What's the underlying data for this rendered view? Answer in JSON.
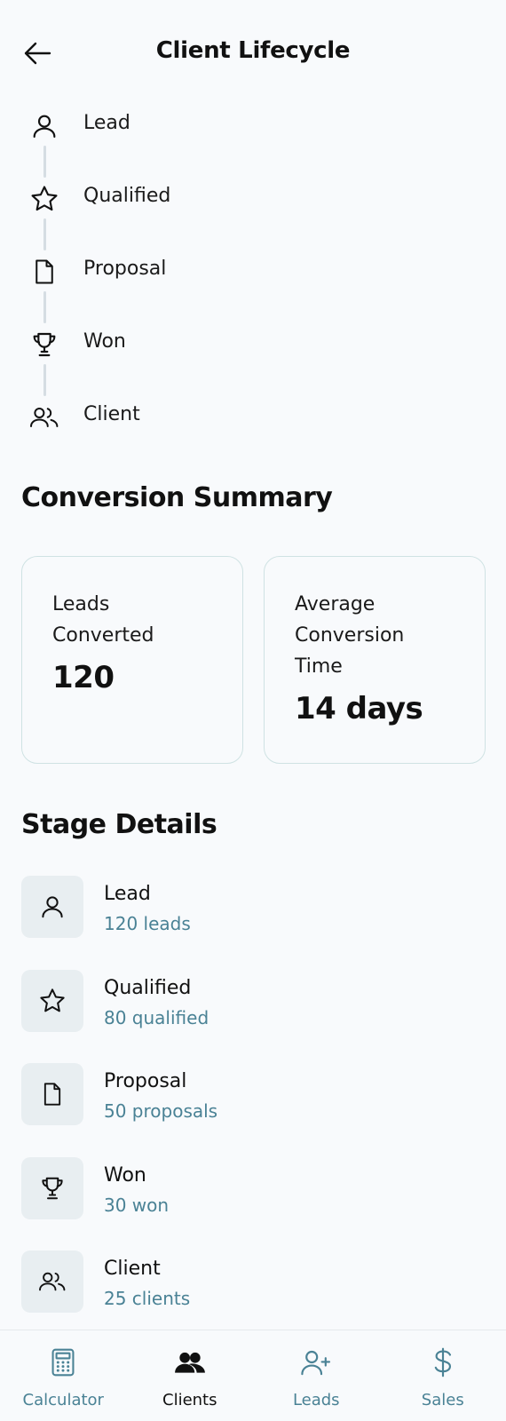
{
  "header": {
    "title": "Client Lifecycle"
  },
  "timeline": [
    {
      "label": "Lead",
      "icon": "user-icon"
    },
    {
      "label": "Qualified",
      "icon": "star-icon"
    },
    {
      "label": "Proposal",
      "icon": "file-icon"
    },
    {
      "label": "Won",
      "icon": "trophy-icon"
    },
    {
      "label": "Client",
      "icon": "users-icon"
    }
  ],
  "summary": {
    "title": "Conversion Summary",
    "cards": [
      {
        "label": "Leads Converted",
        "value": "120"
      },
      {
        "label": "Average Conversion Time",
        "value": "14 days"
      }
    ]
  },
  "stages": {
    "title": "Stage Details",
    "items": [
      {
        "name": "Lead",
        "count": "120 leads",
        "icon": "user-icon"
      },
      {
        "name": "Qualified",
        "count": "80 qualified",
        "icon": "star-icon"
      },
      {
        "name": "Proposal",
        "count": "50 proposals",
        "icon": "file-icon"
      },
      {
        "name": "Won",
        "count": "30 won",
        "icon": "trophy-icon"
      },
      {
        "name": "Client",
        "count": "25 clients",
        "icon": "users-icon"
      }
    ]
  },
  "nav": {
    "items": [
      {
        "label": "Calculator",
        "icon": "calculator-icon",
        "active": false
      },
      {
        "label": "Clients",
        "icon": "users-filled-icon",
        "active": true
      },
      {
        "label": "Leads",
        "icon": "user-plus-icon",
        "active": false
      },
      {
        "label": "Sales",
        "icon": "dollar-icon",
        "active": false
      }
    ]
  },
  "colors": {
    "accent": "#4a8295",
    "background": "#f8fafc",
    "icon_box": "#e8eef1",
    "card_border": "#cfe2e3"
  }
}
